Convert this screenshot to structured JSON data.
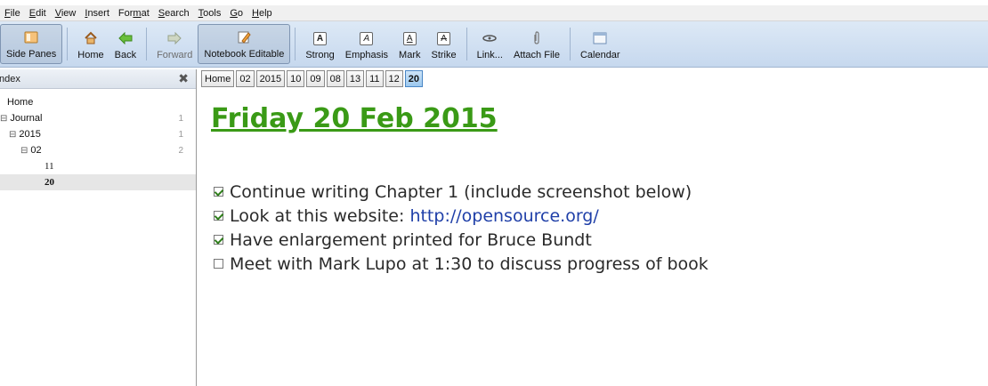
{
  "menu": [
    {
      "label": "File",
      "acc": "F"
    },
    {
      "label": "Edit",
      "acc": "E"
    },
    {
      "label": "View",
      "acc": "V"
    },
    {
      "label": "Insert",
      "acc": "I"
    },
    {
      "label": "Format",
      "acc": "m"
    },
    {
      "label": "Search",
      "acc": "S"
    },
    {
      "label": "Tools",
      "acc": "T"
    },
    {
      "label": "Go",
      "acc": "G"
    },
    {
      "label": "Help",
      "acc": "H"
    }
  ],
  "toolbar": {
    "side_panes": "Side Panes",
    "home": "Home",
    "back": "Back",
    "forward": "Forward",
    "notebook_editable": "Notebook Editable",
    "strong": "Strong",
    "emphasis": "Emphasis",
    "mark": "Mark",
    "strike": "Strike",
    "link": "Link...",
    "attach_file": "Attach File",
    "calendar": "Calendar"
  },
  "sidebar": {
    "title": "ndex",
    "tree": {
      "home": "Home",
      "journal": {
        "label": "Journal",
        "count": "1"
      },
      "year": {
        "label": "2015",
        "count": "1"
      },
      "month": {
        "label": "02",
        "count": "2"
      },
      "day1": "11",
      "day2": "20"
    }
  },
  "pathbar": [
    "Home",
    "02",
    "2015",
    "10",
    "09",
    "08",
    "13",
    "11",
    "12",
    "20"
  ],
  "page": {
    "title": "Friday 20 Feb 2015",
    "tasks": {
      "t1": "Continue writing Chapter 1 (include screenshot below)",
      "t2_prefix": "Look at this website: ",
      "t2_link": "http://opensource.org/",
      "t3": "Have enlargement printed for Bruce Bundt",
      "t4": "Meet with Mark Lupo at 1:30 to discuss progress of book"
    }
  },
  "colors": {
    "title_green": "#3a9a16",
    "link_blue": "#1f3fa8",
    "toolbar_blue": "#c6d8ee"
  }
}
